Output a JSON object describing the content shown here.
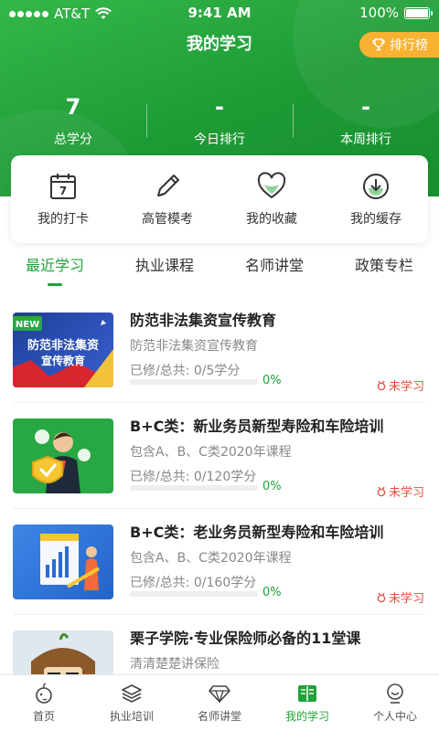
{
  "status_bar": {
    "carrier": "AT&T",
    "time": "9:41 AM",
    "battery": "100%"
  },
  "header": {
    "title": "我的学习",
    "rank_button": "排行榜"
  },
  "stats": [
    {
      "value": "7",
      "label": "总学分"
    },
    {
      "value": "-",
      "label": "今日排行"
    },
    {
      "value": "-",
      "label": "本周排行"
    }
  ],
  "quick_actions": [
    {
      "label": "我的打卡",
      "icon": "calendar-icon",
      "badge": "7"
    },
    {
      "label": "高管模考",
      "icon": "pencil-icon"
    },
    {
      "label": "我的收藏",
      "icon": "heart-icon"
    },
    {
      "label": "我的缓存",
      "icon": "download-icon"
    }
  ],
  "tabs": [
    {
      "label": "最近学习",
      "active": true
    },
    {
      "label": "执业课程",
      "active": false
    },
    {
      "label": "名师讲堂",
      "active": false
    },
    {
      "label": "政策专栏",
      "active": false
    }
  ],
  "courses": [
    {
      "title": "防范非法集资宣传教育",
      "subtitle": "防范非法集资宣传教育",
      "progress_text": "已修/总共: 0/5学分",
      "percent": "0%",
      "progress": 0,
      "status": "未学习",
      "thumb_badge": "NEW",
      "thumb_text_1": "防范非法集资",
      "thumb_text_2": "宣传教育"
    },
    {
      "title": "B+C类：新业务员新型寿险和车险培训",
      "subtitle": "包含A、B、C类2020年课程",
      "progress_text": "已修/总共: 0/120学分",
      "percent": "0%",
      "progress": 0,
      "status": "未学习"
    },
    {
      "title": "B+C类：老业务员新型寿险和车险培训",
      "subtitle": "包含A、B、C类2020年课程",
      "progress_text": "已修/总共: 0/160学分",
      "percent": "0%",
      "progress": 0,
      "status": "未学习"
    },
    {
      "title": "栗子学院·专业保险师必备的11堂课",
      "subtitle": "清清楚楚讲保险"
    }
  ],
  "bottom_nav": [
    {
      "label": "首页",
      "icon": "home-icon",
      "active": false
    },
    {
      "label": "执业培训",
      "icon": "layers-icon",
      "active": false
    },
    {
      "label": "名师讲堂",
      "icon": "diamond-icon",
      "active": false
    },
    {
      "label": "我的学习",
      "icon": "book-icon",
      "active": true
    },
    {
      "label": "个人中心",
      "icon": "user-icon",
      "active": false
    }
  ],
  "colors": {
    "primary": "#1fa337",
    "accent": "#f7b233",
    "alert": "#e84b3c"
  }
}
